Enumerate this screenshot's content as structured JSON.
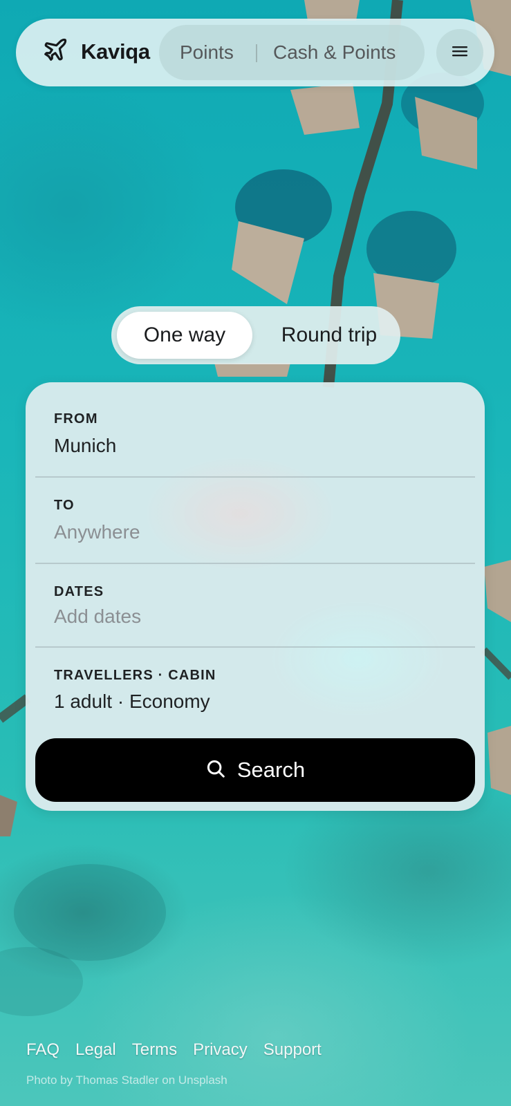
{
  "header": {
    "brand": "Kaviqa",
    "modes": [
      "Points",
      "Cash & Points"
    ],
    "icons": {
      "logo": "airplane-icon",
      "menu": "menu-icon"
    }
  },
  "trip_type": {
    "options": [
      "One way",
      "Round trip"
    ],
    "selected": "One way"
  },
  "search_form": {
    "from": {
      "label": "FROM",
      "value": "Munich"
    },
    "to": {
      "label": "TO",
      "placeholder": "Anywhere"
    },
    "dates": {
      "label": "DATES",
      "placeholder": "Add dates"
    },
    "travellers": {
      "label": "TRAVELLERS · CABIN",
      "value": "1 adult · Economy"
    },
    "search_label": "Search",
    "search_icon": "search-icon"
  },
  "footer": {
    "links": [
      "FAQ",
      "Legal",
      "Terms",
      "Privacy",
      "Support"
    ],
    "credit": "Photo by Thomas Stadler on Unsplash"
  },
  "colors": {
    "water": "#1fb3b5",
    "button": "#000000",
    "text": "#1e2123",
    "placeholder": "#8b8f93"
  }
}
